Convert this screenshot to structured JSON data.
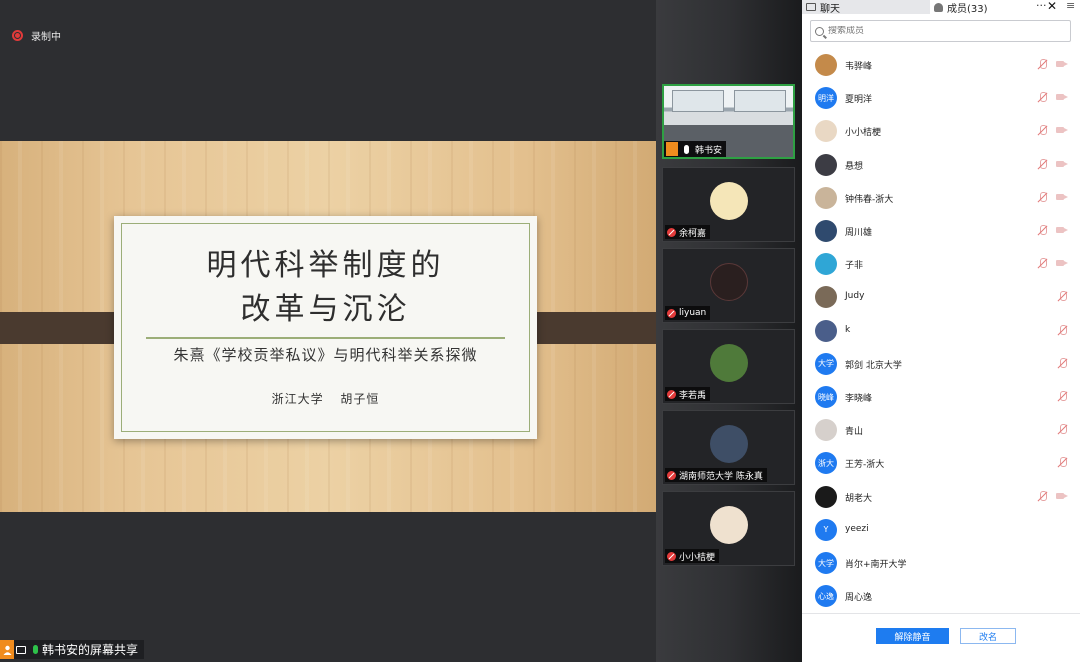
{
  "recording": {
    "label": "录制中"
  },
  "slide": {
    "title_line1": "明代科举制度的",
    "title_line2": "改革与沉沦",
    "subtitle": "朱熹《学校贡举私议》与明代科举关系探微",
    "author": "浙江大学 胡子恒"
  },
  "sharer": {
    "label": "韩书安的屏幕共享"
  },
  "videos": [
    {
      "name": "韩书安"
    },
    {
      "name": "余柯嘉"
    },
    {
      "name": "liyuan"
    },
    {
      "name": "李若禹"
    },
    {
      "name": "湖南师范大学 陈永真"
    },
    {
      "name": "小小桔梗"
    }
  ],
  "tabs": {
    "chat": "聊天",
    "members": "成员(33)"
  },
  "search": {
    "placeholder": "搜索成员"
  },
  "members": [
    {
      "name": "韦骅峰",
      "avatar_text": "",
      "color": "#c48a4a",
      "cam": true
    },
    {
      "name": "夏明洋",
      "avatar_text": "明洋",
      "color": "#1f7af0",
      "cam": true
    },
    {
      "name": "小小桔梗",
      "avatar_text": "",
      "color": "#e9d8c4",
      "cam": true
    },
    {
      "name": "悬想",
      "avatar_text": "",
      "color": "#3c3c44",
      "cam": true
    },
    {
      "name": "钟伟春-浙大",
      "avatar_text": "",
      "color": "#c9b49a",
      "cam": true
    },
    {
      "name": "周川雄",
      "avatar_text": "",
      "color": "#2f4a6e",
      "cam": true
    },
    {
      "name": "子非",
      "avatar_text": "",
      "color": "#2fa6d6",
      "cam": true
    },
    {
      "name": "Judy",
      "avatar_text": "",
      "color": "#7a6a58",
      "cam": false
    },
    {
      "name": "k",
      "avatar_text": "",
      "color": "#4a5e8a",
      "cam": false
    },
    {
      "name": "郭剑 北京大学",
      "avatar_text": "大学",
      "color": "#1f7af0",
      "cam": false
    },
    {
      "name": "李晓峰",
      "avatar_text": "晓峰",
      "color": "#1f7af0",
      "cam": false
    },
    {
      "name": "青山",
      "avatar_text": "",
      "color": "#d6d0cc",
      "cam": false
    },
    {
      "name": "王芳-浙大",
      "avatar_text": "浙大",
      "color": "#1f7af0",
      "cam": false
    },
    {
      "name": "胡老大",
      "avatar_text": "",
      "color": "#1a1a1a",
      "cam": true
    },
    {
      "name": "yeezi",
      "avatar_text": "Y",
      "color": "#1f7af0",
      "cam": null
    },
    {
      "name": "肖尔+南开大学",
      "avatar_text": "大学",
      "color": "#1f7af0",
      "cam": null
    },
    {
      "name": "周心逸",
      "avatar_text": "心逸",
      "color": "#1f7af0",
      "cam": null
    }
  ],
  "footer": {
    "unmute": "解除静音",
    "rename": "改名"
  }
}
